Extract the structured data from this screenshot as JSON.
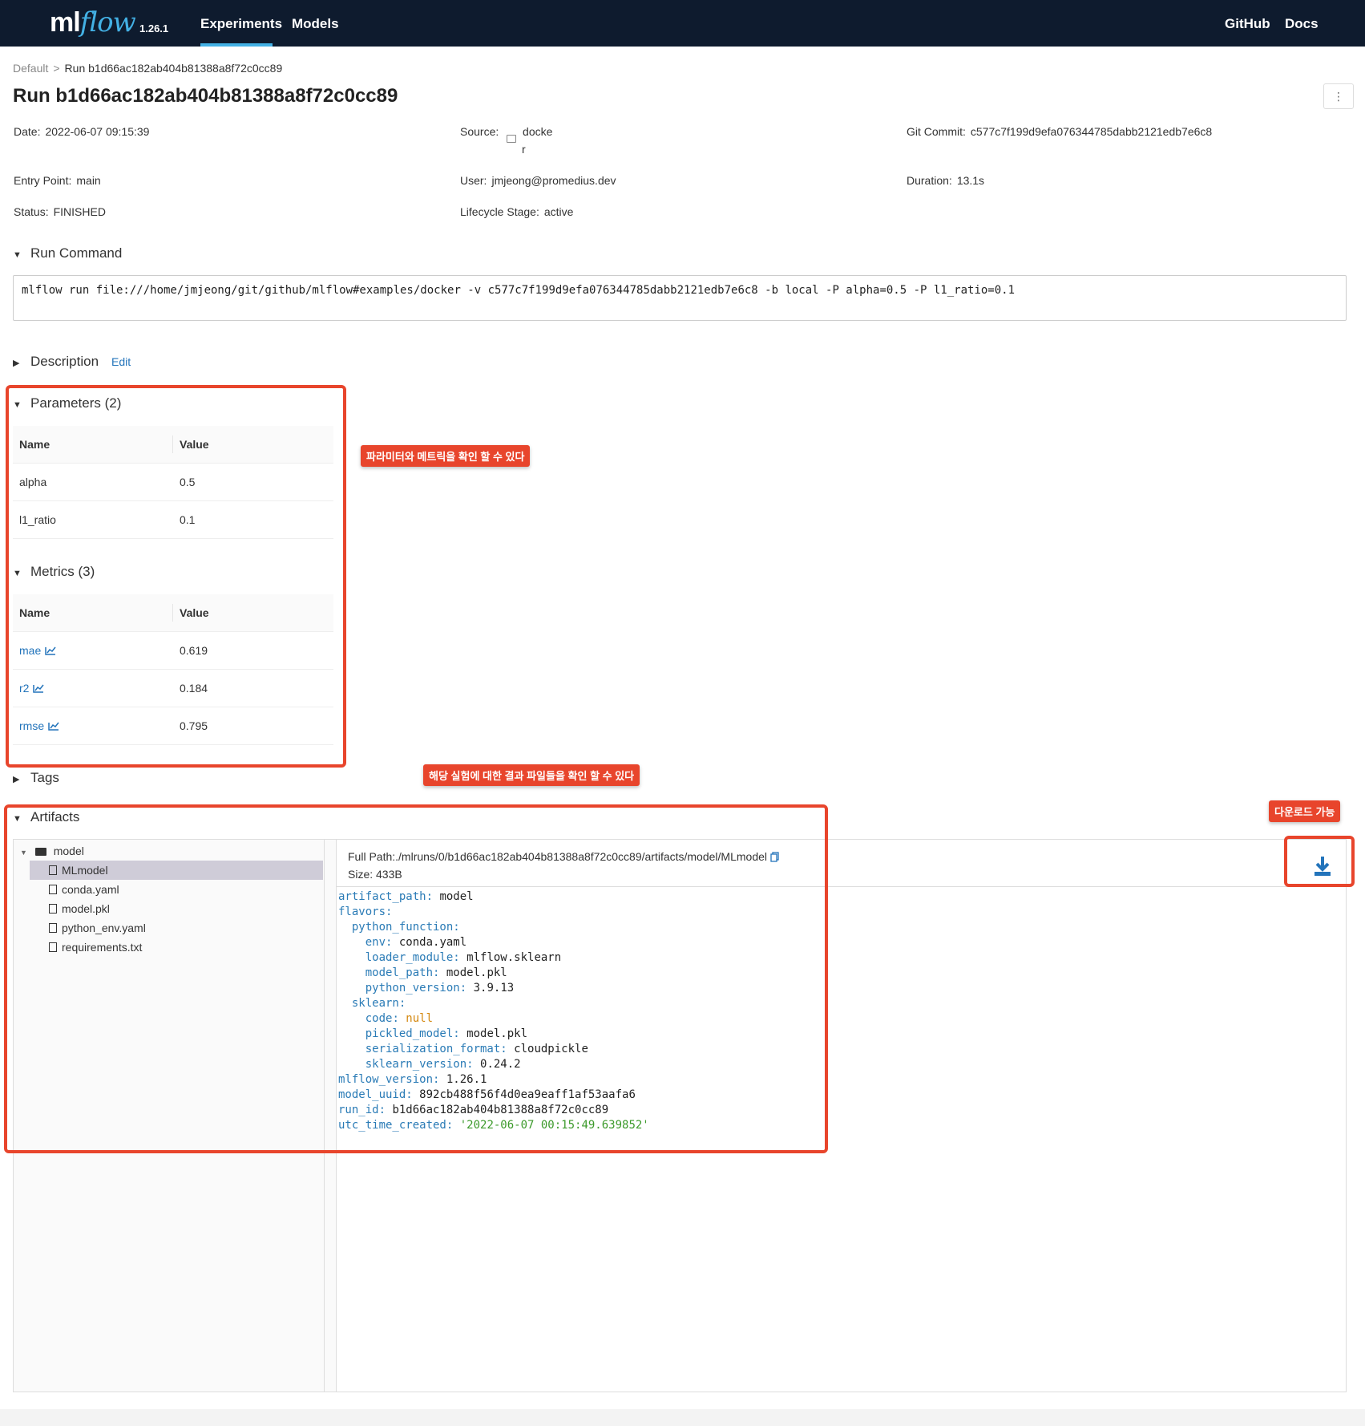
{
  "header": {
    "logo_ml": "ml",
    "logo_flow": "flow",
    "version": "1.26.1",
    "nav_experiments": "Experiments",
    "nav_models": "Models",
    "nav_github": "GitHub",
    "nav_docs": "Docs"
  },
  "breadcrumb": {
    "home": "Default",
    "sep": ">",
    "current": "Run b1d66ac182ab404b81388a8f72c0cc89"
  },
  "title": "Run b1d66ac182ab404b81388a8f72c0cc89",
  "kebab": "⋮",
  "meta": {
    "date_label": "Date:",
    "date_value": "2022-06-07 09:15:39",
    "source_label": "Source:",
    "source_value_1": "docke",
    "source_value_2": "r",
    "git_label": "Git Commit:",
    "git_value": "c577c7f199d9efa076344785dabb2121edb7e6c8",
    "entry_label": "Entry Point:",
    "entry_value": "main",
    "user_label": "User:",
    "user_value": "jmjeong@promedius.dev",
    "duration_label": "Duration:",
    "duration_value": "13.1s",
    "status_label": "Status:",
    "status_value": "FINISHED",
    "lifecycle_label": "Lifecycle Stage:",
    "lifecycle_value": "active"
  },
  "run_command": {
    "heading": "Run Command",
    "text": "mlflow run file:///home/jmjeong/git/github/mlflow#examples/docker -v c577c7f199d9efa076344785dabb2121edb7e6c8 -b local -P alpha=0.5 -P l1_ratio=0.1"
  },
  "description": {
    "heading": "Description",
    "edit": "Edit"
  },
  "parameters": {
    "heading": "Parameters (2)",
    "col_name": "Name",
    "col_value": "Value",
    "rows": [
      {
        "name": "alpha",
        "value": "0.5"
      },
      {
        "name": "l1_ratio",
        "value": "0.1"
      }
    ]
  },
  "metrics": {
    "heading": "Metrics (3)",
    "col_name": "Name",
    "col_value": "Value",
    "rows": [
      {
        "name": "mae",
        "value": "0.619"
      },
      {
        "name": "r2",
        "value": "0.184"
      },
      {
        "name": "rmse",
        "value": "0.795"
      }
    ]
  },
  "tags": {
    "heading": "Tags"
  },
  "artifacts": {
    "heading": "Artifacts",
    "tree": [
      "model",
      "MLmodel",
      "conda.yaml",
      "model.pkl",
      "python_env.yaml",
      "requirements.txt"
    ],
    "full_path": "Full Path:./mlruns/0/b1d66ac182ab404b81388a8f72c0cc89/artifacts/model/MLmodel",
    "size": "Size: 433B",
    "yaml": [
      {
        "key": "artifact_path",
        "val": "model",
        "indent": ""
      },
      {
        "key": "flavors",
        "val": "",
        "indent": ""
      },
      {
        "key": "python_function",
        "val": "",
        "indent": "  "
      },
      {
        "key": "env",
        "val": "conda.yaml",
        "indent": "    "
      },
      {
        "key": "loader_module",
        "val": "mlflow.sklearn",
        "indent": "    "
      },
      {
        "key": "model_path",
        "val": "model.pkl",
        "indent": "    "
      },
      {
        "key": "python_version",
        "val": "3.9.13",
        "indent": "    "
      },
      {
        "key": "sklearn",
        "val": "",
        "indent": "  "
      },
      {
        "key": "code",
        "val": "null",
        "indent": "    "
      },
      {
        "key": "pickled_model",
        "val": "model.pkl",
        "indent": "    "
      },
      {
        "key": "serialization_format",
        "val": "cloudpickle",
        "indent": "    "
      },
      {
        "key": "sklearn_version",
        "val": "0.24.2",
        "indent": "    "
      },
      {
        "key": "mlflow_version",
        "val": "1.26.1",
        "indent": ""
      },
      {
        "key": "model_uuid",
        "val": "892cb488f56f4d0ea9eaff1af53aafa6",
        "indent": ""
      },
      {
        "key": "run_id",
        "val": "b1d66ac182ab404b81388a8f72c0cc89",
        "indent": ""
      },
      {
        "key": "utc_time_created",
        "val": "'2022-06-07 00:15:49.639852'",
        "indent": ""
      }
    ]
  },
  "annotations": {
    "params_note": "파라미터와 메트릭을 확인 할 수 있다",
    "artifacts_note": "해당 실험에 대한 결과 파일들을 확인 할 수 있다",
    "download_note": "다운로드 가능"
  },
  "colors": {
    "header_bg": "#0e1b2e",
    "accent": "#43b1e5",
    "link": "#2374bb",
    "annotation": "#e8452c"
  }
}
